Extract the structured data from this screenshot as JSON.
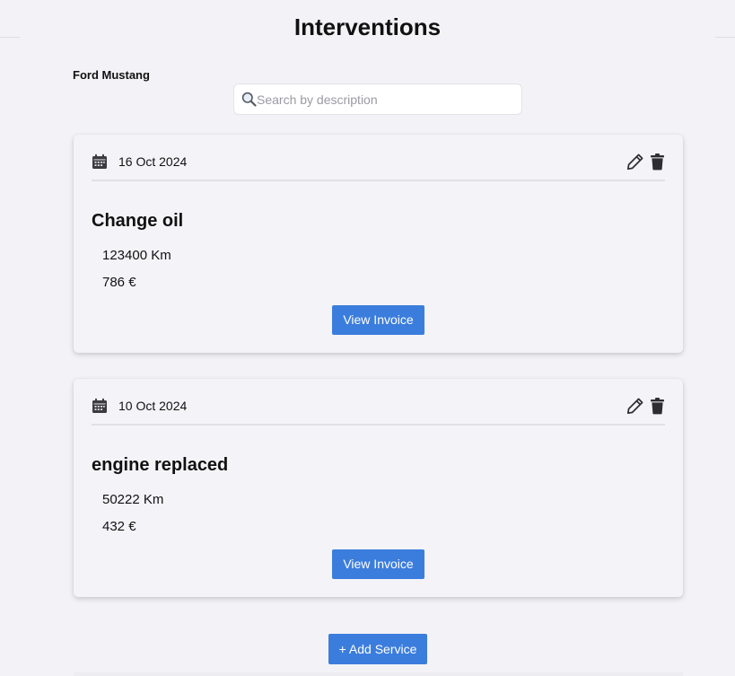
{
  "page": {
    "title": "Interventions"
  },
  "vehicle": {
    "name": "Ford Mustang"
  },
  "search": {
    "placeholder": "Search by description",
    "value": ""
  },
  "interventions": [
    {
      "date": "16 Oct 2024",
      "description": "Change oil",
      "mileage": "123400 Km",
      "price": "786 €",
      "invoice_label": "View Invoice"
    },
    {
      "date": "10 Oct 2024",
      "description": "engine replaced",
      "mileage": "50222 Km",
      "price": "432 €",
      "invoice_label": "View Invoice"
    }
  ],
  "actions": {
    "add_service_label": "+ Add Service"
  },
  "icons": {
    "search": "search-icon",
    "calendar": "calendar-icon",
    "edit": "pencil-icon",
    "delete": "trash-icon"
  },
  "colors": {
    "background": "#f3f3f7",
    "accent": "#3b7ddd",
    "text": "#111111"
  }
}
